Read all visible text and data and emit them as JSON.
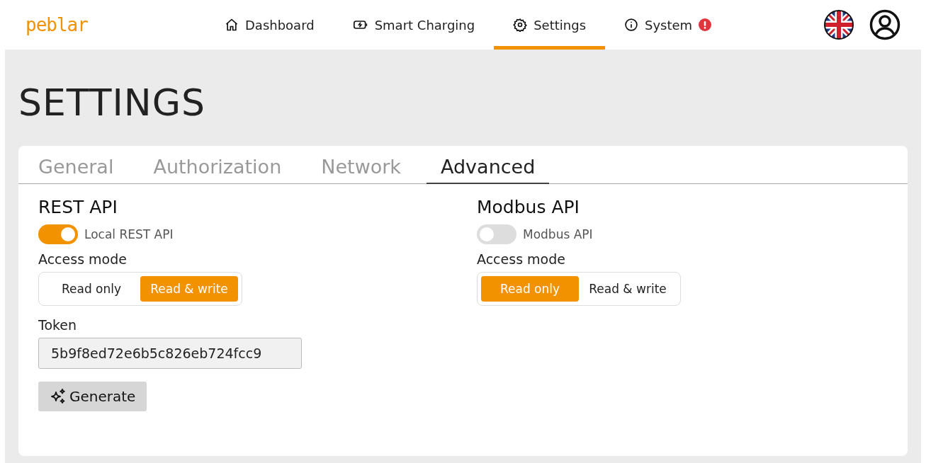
{
  "brand": "peblar",
  "nav": [
    {
      "label": "Dashboard",
      "kind": "home",
      "selected": false,
      "alert": false
    },
    {
      "label": "Smart Charging",
      "kind": "charging",
      "selected": false,
      "alert": false
    },
    {
      "label": "Settings",
      "kind": "settings",
      "selected": true,
      "alert": false
    },
    {
      "label": "System",
      "kind": "system",
      "selected": false,
      "alert": true
    }
  ],
  "page_title": "SETTINGS",
  "tabs": [
    {
      "label": "General",
      "selected": false
    },
    {
      "label": "Authorization",
      "selected": false
    },
    {
      "label": "Network",
      "selected": false
    },
    {
      "label": "Advanced",
      "selected": true
    }
  ],
  "sections": [
    {
      "title": "REST API",
      "toggle": {
        "label": "Local REST API",
        "on": true
      },
      "access_label": "Access mode",
      "modes": [
        {
          "label": "Read only",
          "selected": false
        },
        {
          "label": "Read & write",
          "selected": true
        }
      ],
      "token": {
        "label": "Token",
        "value": "5b9f8ed72e6b5c826eb724fcc9"
      },
      "button": "Generate"
    },
    {
      "title": "Modbus API",
      "toggle": {
        "label": "Modbus API",
        "on": false
      },
      "access_label": "Access mode",
      "modes": [
        {
          "label": "Read only",
          "selected": true
        },
        {
          "label": "Read & write",
          "selected": false
        }
      ]
    }
  ]
}
